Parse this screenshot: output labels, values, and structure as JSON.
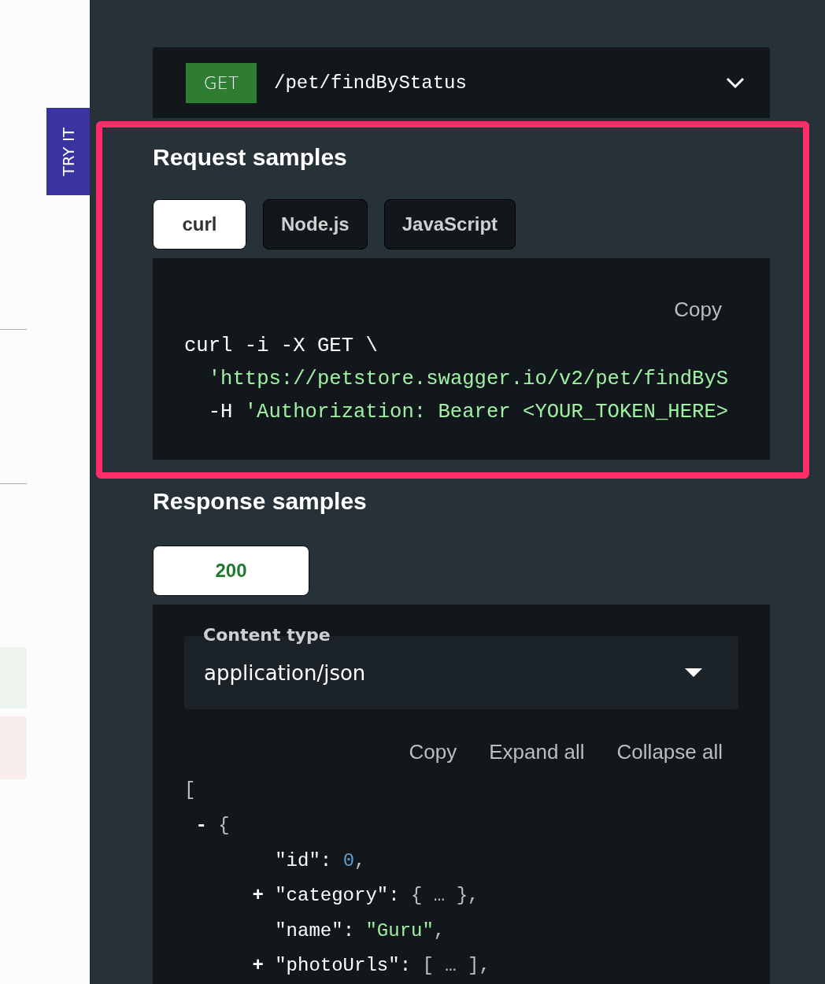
{
  "try_it": {
    "label": "TRY IT"
  },
  "endpoint": {
    "method": "GET",
    "path": "/pet/findByStatus"
  },
  "request_samples": {
    "title": "Request samples",
    "tabs": [
      {
        "label": "curl",
        "selected": true
      },
      {
        "label": "Node.js",
        "selected": false
      },
      {
        "label": "JavaScript",
        "selected": false
      }
    ],
    "copy": "Copy",
    "code_lines": [
      {
        "kind": "command",
        "parts": [
          {
            "kind": "plain",
            "text": "curl -i -X GET \\"
          }
        ]
      },
      {
        "kind": "continuation",
        "parts": [
          {
            "kind": "string",
            "text": "'https://petstore.swagger.io/v2/pet/findByS"
          }
        ]
      },
      {
        "kind": "continuation",
        "parts": [
          {
            "kind": "plain",
            "text": "-H"
          },
          {
            "kind": "string",
            "text": "'Authorization: Bearer <YOUR_TOKEN_HERE>"
          }
        ]
      }
    ]
  },
  "response_samples": {
    "title": "Response samples",
    "tabs": [
      {
        "label": "200",
        "selected": true
      }
    ],
    "content_type": {
      "label": "Content type",
      "value": "application/json"
    },
    "actions": [
      "Copy",
      "Expand all",
      "Collapse all"
    ],
    "json_lines": [
      {
        "kind": "root",
        "parts": [
          {
            "kind": "punct",
            "text": "["
          }
        ]
      },
      {
        "kind": "item",
        "parts": [
          {
            "kind": "toggle",
            "text": "-"
          },
          {
            "kind": "punct",
            "text": "{"
          }
        ]
      },
      {
        "kind": "field",
        "parts": [
          {
            "kind": "key",
            "text": "\"id\":"
          },
          {
            "kind": "number",
            "text": "0"
          },
          {
            "kind": "punct",
            "text": ","
          }
        ]
      },
      {
        "kind": "collapsible",
        "parts": [
          {
            "kind": "toggle",
            "text": "+"
          },
          {
            "kind": "key",
            "text": "\"category\":"
          },
          {
            "kind": "punct",
            "text": "{ … },"
          }
        ]
      },
      {
        "kind": "field",
        "parts": [
          {
            "kind": "key",
            "text": "\"name\":"
          },
          {
            "kind": "string",
            "text": "\"Guru\""
          },
          {
            "kind": "punct",
            "text": ","
          }
        ]
      },
      {
        "kind": "collapsible",
        "parts": [
          {
            "kind": "toggle",
            "text": "+"
          },
          {
            "kind": "key",
            "text": "\"photoUrls\":"
          },
          {
            "kind": "punct",
            "text": "[ … ],"
          }
        ]
      }
    ]
  }
}
